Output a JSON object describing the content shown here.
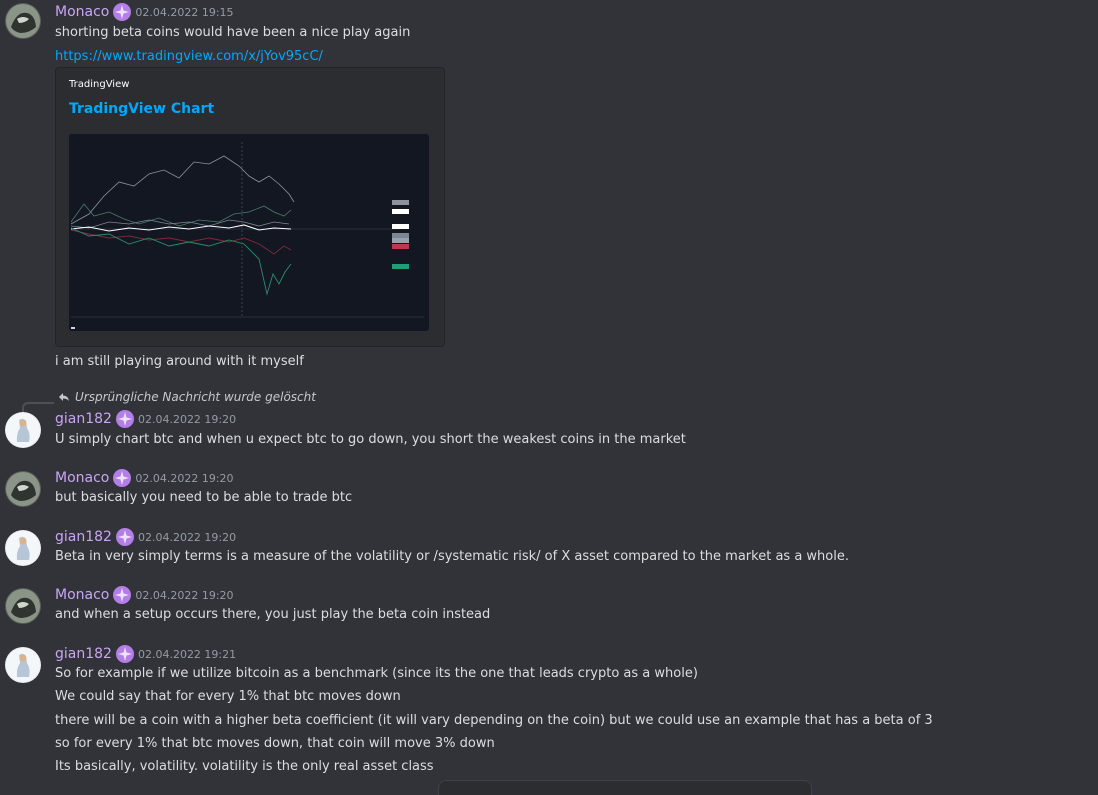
{
  "messages": {
    "m1": {
      "author": "Monaco",
      "timestamp": "02.04.2022 19:15",
      "lines": [
        "shorting beta coins would have been a nice play again",
        "https://www.tradingview.com/x/jYov95cC/"
      ],
      "embed": {
        "provider": "TradingView",
        "title": "TradingView Chart",
        "image_brand": "TradingView"
      },
      "after_embed": "i am still playing around with it myself"
    },
    "reply_note": "Ursprüngliche Nachricht wurde gelöscht",
    "m2": {
      "author": "gian182",
      "timestamp": "02.04.2022 19:20",
      "line": "U simply chart btc and when u expect btc to go down, you short the weakest coins in the market"
    },
    "m3": {
      "author": "Monaco",
      "timestamp": "02.04.2022 19:20",
      "line": "but basically you need to be able to trade btc"
    },
    "m4": {
      "author": "gian182",
      "timestamp": "02.04.2022 19:20",
      "line": "Beta in very simply terms is a measure of the volatility or /systematic risk/ of X asset compared to the market as a whole."
    },
    "m5": {
      "author": "Monaco",
      "timestamp": "02.04.2022 19:20",
      "line": "and when a setup occurs there, you just play the beta coin instead"
    },
    "m6": {
      "author": "gian182",
      "timestamp": "02.04.2022 19:21",
      "lines": [
        "So for example if we utilize bitcoin as a benchmark (since its the one that leads crypto as a whole)",
        "We could say that for every 1% that btc moves down",
        "there will be a coin with a higher beta coefficient (it will vary depending on the coin) but we could use an example that has a beta of 3",
        "so for every 1% that btc moves down, that coin will move 3% down",
        "Its basically, volatility. volatility is the only real asset class"
      ]
    }
  },
  "colors": {
    "background": "#313338",
    "username": "#c9a5f2",
    "link": "#00a8fc",
    "timestamp": "#949ba4",
    "text": "#dbdee1"
  },
  "icons": {
    "badge": "nitro-badge-icon",
    "reply": "reply-arrow-icon"
  }
}
